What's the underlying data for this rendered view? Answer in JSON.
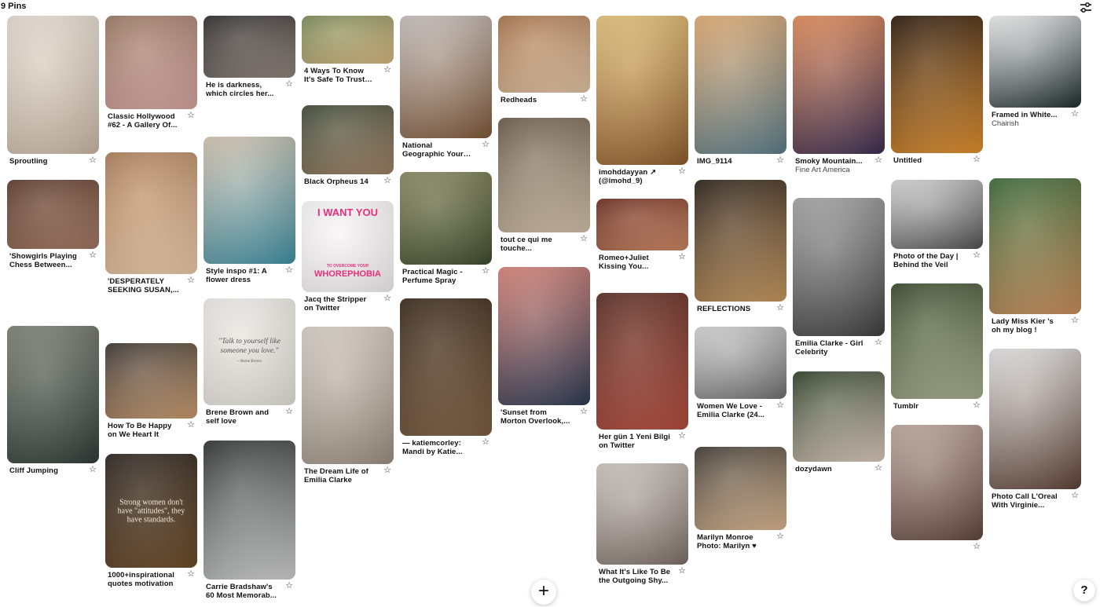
{
  "header": {
    "pin_count": "9 Pins"
  },
  "pins": {
    "c0": [
      {
        "title": "Sproutling",
        "subtitle": "",
        "img": [
          "#e7dfd6",
          "#c8b6a4"
        ]
      },
      {
        "title": "'Showgirls Playing Chess Between...",
        "subtitle": "",
        "img": [
          "#5b3b2c",
          "#a27560"
        ]
      },
      {
        "title": "Cliff Jumping",
        "subtitle": "",
        "img": [
          "#7d8376",
          "#2f3a36"
        ]
      }
    ],
    "c1": [
      {
        "title": "Classic Hollywood #62 - A Gallery Of...",
        "subtitle": "",
        "img": [
          "#9c7b66",
          "#d5a3a0"
        ]
      },
      {
        "title": "'DESPERATELY SEEKING SUSAN,...",
        "subtitle": "",
        "img": [
          "#b0805a",
          "#e9c9a6"
        ]
      },
      {
        "title": "How To Be Happy on We Heart It",
        "subtitle": "",
        "img": [
          "#3a3633",
          "#c9996b"
        ]
      },
      {
        "title": "1000+inspirational quotes motivation",
        "subtitle": "",
        "img": [
          "#2b2420",
          "#6b4a26"
        ],
        "text": "Strong women don't have \"attitudes\", they have standards."
      }
    ],
    "c2": [
      {
        "title": "He is darkness, which circles her...",
        "subtitle": "",
        "img": [
          "#2e2b2a",
          "#8e827a"
        ]
      },
      {
        "title": "Style inspo #1: A flower dress",
        "subtitle": "",
        "img": [
          "#d8c6b3",
          "#3f8fa2"
        ]
      },
      {
        "title": "Brene Brown and self love",
        "subtitle": "",
        "img": [
          "#efece8",
          "#e3ded8"
        ],
        "text": "\"Talk to yourself like someone you love.\"",
        "by": "~ Brene Brown"
      },
      {
        "title": "Carrie Bradshaw's 60 Most Memorab...",
        "subtitle": "",
        "img": [
          "#2f3232",
          "#cfcfcf"
        ]
      }
    ],
    "c3": [
      {
        "title": "4 Ways To Know It's Safe To Trust Agai...",
        "subtitle": "",
        "img": [
          "#7c8c5a",
          "#d5b57f"
        ]
      },
      {
        "title": "Black Orpheus 14",
        "subtitle": "",
        "img": [
          "#3e4a38",
          "#9c7f63"
        ]
      },
      {
        "title": "Jacq the Stripper on Twitter",
        "subtitle": "",
        "img": [
          "#fbfafa",
          "#f2eef0"
        ],
        "poster": [
          "I WANT YOU",
          "TO OVERCOME YOUR",
          "WHOREPHOBIA"
        ]
      },
      {
        "title": "The Dream Life of Emilia Clarke",
        "subtitle": "",
        "img": [
          "#d9d1c8",
          "#9a8d80"
        ]
      }
    ],
    "c4": [
      {
        "title": "National Geographic Your Shot",
        "subtitle": "",
        "img": [
          "#c8c2c0",
          "#7d5738"
        ]
      },
      {
        "title": "Practical Magic - Perfume Spray",
        "subtitle": "",
        "img": [
          "#8a8a60",
          "#3e4a2d"
        ]
      },
      {
        "title": "— katiemcorley: Mandi by Katie...",
        "subtitle": "",
        "img": [
          "#3a2a1c",
          "#7b5d3f"
        ]
      }
    ],
    "c5": [
      {
        "title": "Redheads",
        "subtitle": "",
        "img": [
          "#a8754c",
          "#e0c3a2"
        ]
      },
      {
        "title": "tout ce qui me touche...",
        "subtitle": "",
        "img": [
          "#6b5a4a",
          "#d1c0a8"
        ]
      },
      {
        "title": "'Sunset from Morton Overlook,...",
        "subtitle": "",
        "img": [
          "#d98378",
          "#2c3a52"
        ]
      }
    ],
    "c6": [
      {
        "title": "imohddayyan ↗ (@imohd_9)",
        "subtitle": "",
        "img": [
          "#e6c47c",
          "#8e5b2a"
        ]
      },
      {
        "title": "Romeo+Juliet Kissing You...",
        "subtitle": "",
        "img": [
          "#6b2c1e",
          "#c98461"
        ]
      },
      {
        "title": "Her gün 1 Yeni Bilgi on Twitter",
        "subtitle": "",
        "img": [
          "#5a2e24",
          "#b24a3c"
        ]
      },
      {
        "title": "What It's Like To Be the Outgoing Shy...",
        "subtitle": "",
        "img": [
          "#cfc8c2",
          "#7b6e66"
        ]
      }
    ],
    "c7": [
      {
        "title": "IMG_9114",
        "subtitle": "",
        "img": [
          "#e3ac72",
          "#5a7c8a"
        ]
      },
      {
        "title": "REFLECTIONS",
        "subtitle": "",
        "img": [
          "#2b2119",
          "#c4965d"
        ]
      },
      {
        "title": "Women We Love - Emilia Clarke (24...",
        "subtitle": "",
        "img": [
          "#d6d6d6",
          "#6d6d6d"
        ]
      },
      {
        "title": "Marilyn Monroe Photo: Marilyn ♥",
        "subtitle": "",
        "img": [
          "#3f3a34",
          "#d9b58e"
        ]
      }
    ],
    "c8": [
      {
        "title": "Smoky Mountain...",
        "subtitle": "Fine Art America",
        "img": [
          "#e58d59",
          "#3b2e52"
        ]
      },
      {
        "title": "Emilia Clarke - Girl Celebrity",
        "subtitle": "",
        "img": [
          "#a8a8a8",
          "#3e3e3e"
        ]
      },
      {
        "title": "dozydawn",
        "subtitle": "",
        "img": [
          "#2e4028",
          "#d9c8bb"
        ]
      }
    ],
    "c9": [
      {
        "title": "Untitled",
        "subtitle": "",
        "img": [
          "#2b1a0d",
          "#e08e2c"
        ]
      },
      {
        "title": "Photo of the Day | Behind the Veil",
        "subtitle": "",
        "img": [
          "#d8d8d8",
          "#505050"
        ]
      },
      {
        "title": "Tumblr",
        "subtitle": "",
        "img": [
          "#3a4a2c",
          "#a6ad8d"
        ]
      },
      {
        "title": "",
        "subtitle": "",
        "img": [
          "#c0aaa0",
          "#5e463e"
        ]
      }
    ],
    "c10": [
      {
        "title": "Framed in White...",
        "subtitle": "Chairish",
        "img": [
          "#f1f1f1",
          "#1c2a2c"
        ]
      },
      {
        "title": "Lady Miss Kier 's oh my blog !",
        "subtitle": "",
        "img": [
          "#3b6b3a",
          "#c98b5a"
        ]
      },
      {
        "title": "Photo Call L'Oreal With Virginie...",
        "subtitle": "",
        "img": [
          "#e6e6e6",
          "#5a4034"
        ]
      }
    ]
  }
}
